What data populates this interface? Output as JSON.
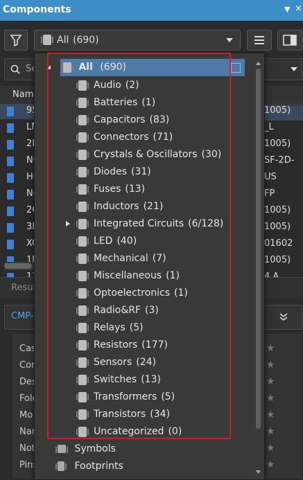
{
  "panel": {
    "title": "Components",
    "pin_glyph": "▼",
    "close_glyph": "×"
  },
  "toolbar": {
    "selector_value": "All",
    "selector_count": "(690)"
  },
  "search": {
    "placeholder_partial": "Se"
  },
  "table": {
    "header_partial": "Name",
    "left_rows": [
      "95",
      "LN",
      "2D",
      "NC",
      "HC",
      "NC",
      "2C",
      "3K",
      "XC",
      "1D",
      "11"
    ],
    "right_rows": [
      "1005)",
      "_L",
      "1005)",
      "SF-2D-",
      "US",
      "FP",
      "1005)",
      "1005)",
      "01602",
      "1005)",
      "4 A"
    ]
  },
  "results_partial": "Result",
  "section_partial": "CMP-",
  "props_partial": [
    "Cas",
    "Cor",
    "Des",
    "Fold",
    "Mo",
    "Nar",
    "Not",
    "Pins"
  ],
  "tree": {
    "root": {
      "label": "All",
      "count": "(690)"
    },
    "items": [
      {
        "label": "Audio",
        "count": "(2)"
      },
      {
        "label": "Batteries",
        "count": "(1)"
      },
      {
        "label": "Capacitors",
        "count": "(83)"
      },
      {
        "label": "Connectors",
        "count": "(71)"
      },
      {
        "label": "Crystals & Oscillators",
        "count": "(30)"
      },
      {
        "label": "Diodes",
        "count": "(31)"
      },
      {
        "label": "Fuses",
        "count": "(13)"
      },
      {
        "label": "Inductors",
        "count": "(21)"
      },
      {
        "label": "Integrated Circuits",
        "count": "(6/128)"
      },
      {
        "label": "LED",
        "count": "(40)"
      },
      {
        "label": "Mechanical",
        "count": "(7)"
      },
      {
        "label": "Miscellaneous",
        "count": "(1)"
      },
      {
        "label": "Optoelectronics",
        "count": "(1)"
      },
      {
        "label": "Radio&RF",
        "count": "(3)"
      },
      {
        "label": "Relays",
        "count": "(5)"
      },
      {
        "label": "Resistors",
        "count": "(177)"
      },
      {
        "label": "Sensors",
        "count": "(24)"
      },
      {
        "label": "Switches",
        "count": "(13)"
      },
      {
        "label": "Transformers",
        "count": "(5)"
      },
      {
        "label": "Transistors",
        "count": "(34)"
      },
      {
        "label": "Uncategorized",
        "count": "(0)"
      }
    ],
    "symbols_label": "Symbols",
    "footprints_label": "Footprints"
  }
}
